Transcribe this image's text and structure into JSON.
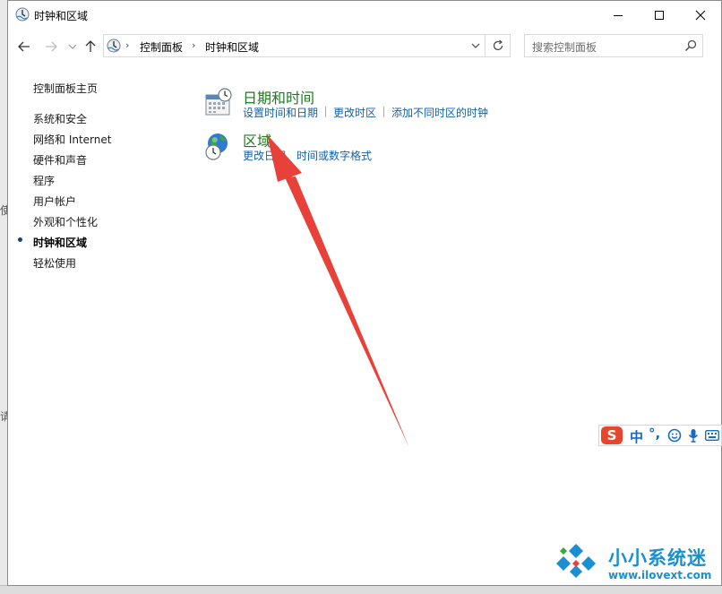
{
  "window": {
    "title": "时钟和区域",
    "controls": {
      "minimize": "minimize",
      "maximize": "maximize",
      "close": "close"
    }
  },
  "background": {
    "fragments": [
      "使",
      "请"
    ]
  },
  "address": {
    "crumbs": [
      "控制面板",
      "时钟和区域"
    ]
  },
  "search": {
    "placeholder": "搜索控制面板"
  },
  "sidebar": {
    "home": "控制面板主页",
    "items": [
      {
        "label": "系统和安全",
        "active": false
      },
      {
        "label": "网络和 Internet",
        "active": false
      },
      {
        "label": "硬件和声音",
        "active": false
      },
      {
        "label": "程序",
        "active": false
      },
      {
        "label": "用户帐户",
        "active": false
      },
      {
        "label": "外观和个性化",
        "active": false
      },
      {
        "label": "时钟和区域",
        "active": true
      },
      {
        "label": "轻松使用",
        "active": false
      }
    ]
  },
  "categories": [
    {
      "title": "日期和时间",
      "icon": "calendar-clock-icon",
      "links": [
        "设置时间和日期",
        "更改时区",
        "添加不同时区的时钟"
      ]
    },
    {
      "title": "区域",
      "icon": "globe-clock-icon",
      "links": [
        "更改日期、时间或数字格式"
      ]
    }
  ],
  "ime": {
    "logo": "S",
    "mode": "中",
    "punct": "°,"
  },
  "watermark": {
    "name": "小小系统迷",
    "url": "www.ilovext.com"
  },
  "colors": {
    "link": "#1460a8",
    "category_title": "#1e7a1e",
    "annotation": "#e8413a"
  }
}
